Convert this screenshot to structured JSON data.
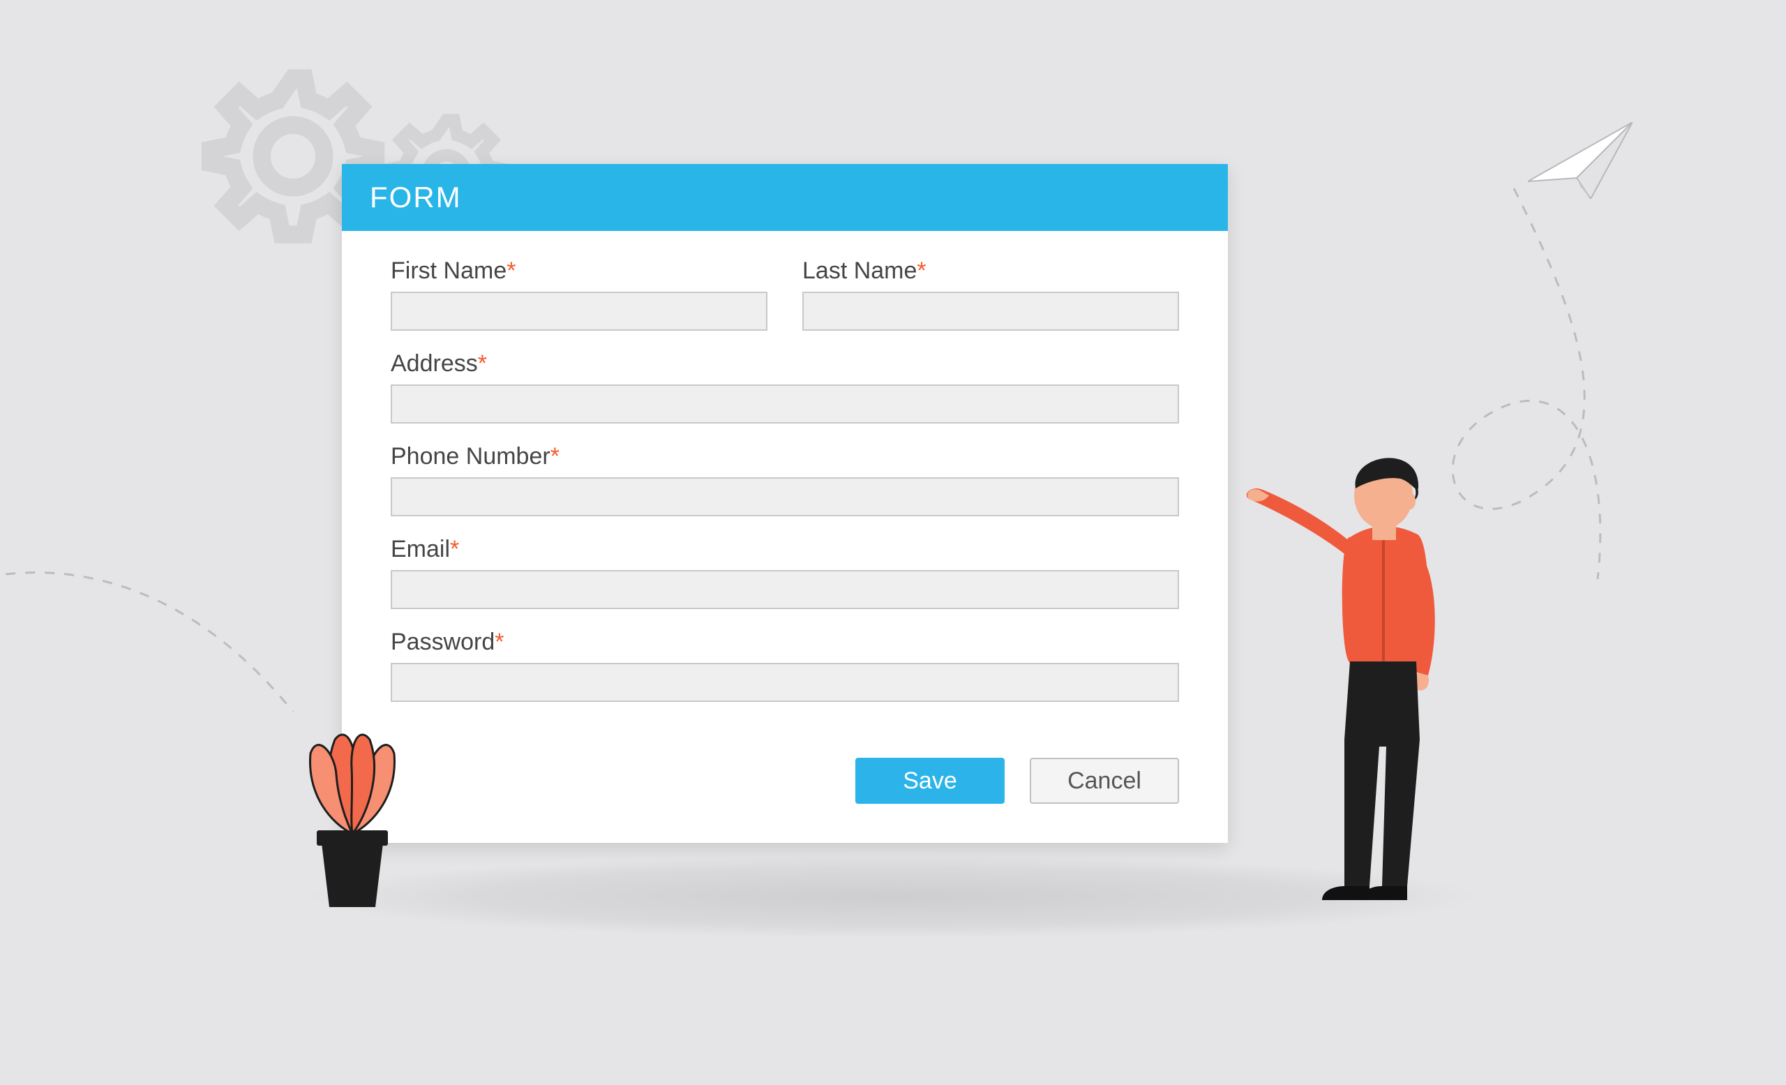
{
  "form": {
    "title": "FORM",
    "fields": {
      "first_name": {
        "label": "First Name",
        "required": "*",
        "value": ""
      },
      "last_name": {
        "label": "Last Name",
        "required": "*",
        "value": ""
      },
      "address": {
        "label": "Address",
        "required": "*",
        "value": ""
      },
      "phone": {
        "label": "Phone Number",
        "required": "*",
        "value": ""
      },
      "email": {
        "label": "Email",
        "required": "*",
        "value": ""
      },
      "password": {
        "label": "Password",
        "required": "*",
        "value": ""
      }
    },
    "actions": {
      "save_label": "Save",
      "cancel_label": "Cancel"
    }
  },
  "colors": {
    "accent": "#29b5e8",
    "required_marker": "#f55b2c"
  }
}
